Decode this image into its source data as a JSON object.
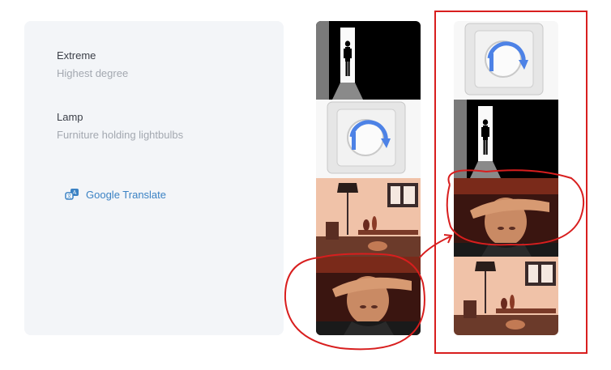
{
  "definitions": [
    {
      "title": "Extreme",
      "description": "Highest degree"
    },
    {
      "title": "Lamp",
      "description": "Furniture holding lightbulbs"
    }
  ],
  "translate": {
    "label": "Google Translate",
    "icon": "translate-icon"
  },
  "columns": {
    "left": [
      "door-silhouette-image",
      "dimmer-switch-image",
      "room-lamp-image",
      "man-shielding-eyes-image"
    ],
    "right": [
      "dimmer-switch-image",
      "door-silhouette-image",
      "man-shielding-eyes-image",
      "room-lamp-image"
    ]
  },
  "annotation": {
    "color": "#d81e1e"
  }
}
